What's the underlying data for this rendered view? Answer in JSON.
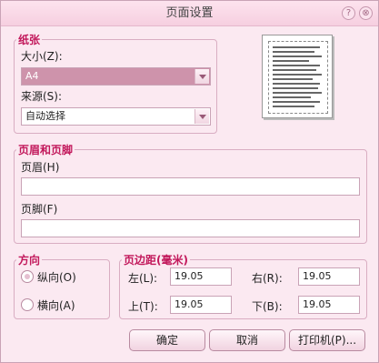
{
  "window": {
    "title": "页面设置",
    "help_icon": "?",
    "close_icon": "⊗"
  },
  "paper": {
    "legend": "纸张",
    "size_label": "大小(Z):",
    "size_value": "A4",
    "source_label": "来源(S):",
    "source_value": "自动选择"
  },
  "header_footer": {
    "legend": "页眉和页脚",
    "header_label": "页眉(H)",
    "header_value": "",
    "footer_label": "页脚(F)",
    "footer_value": ""
  },
  "orientation": {
    "legend": "方向",
    "portrait_label": "纵向(O)",
    "landscape_label": "横向(A)",
    "selected": "portrait"
  },
  "margins": {
    "legend": "页边距(毫米)",
    "left_label": "左(L):",
    "left_value": "19.05",
    "right_label": "右(R):",
    "right_value": "19.05",
    "top_label": "上(T):",
    "top_value": "19.05",
    "bottom_label": "下(B):",
    "bottom_value": "19.05"
  },
  "buttons": {
    "ok": "确定",
    "cancel": "取消",
    "printer": "打印机(P)..."
  },
  "colors": {
    "accent": "#c2185b",
    "background": "#fbe9f1",
    "selection": "#ce93ab"
  }
}
